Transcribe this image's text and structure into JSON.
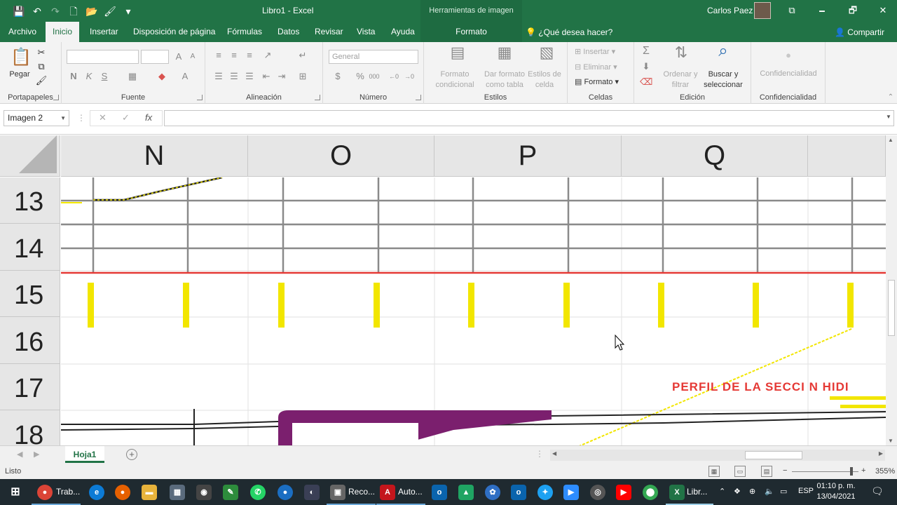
{
  "window": {
    "title": "Libro1  -  Excel",
    "context_tab_group": "Herramientas de imagen",
    "user": "Carlos Paez",
    "minimize": "🗕",
    "restore": "🗗",
    "close": "✕",
    "ribbon_display": "⧉"
  },
  "qat": {
    "save": "💾",
    "undo": "↶",
    "redo": "↷",
    "new": "🗋",
    "open": "📂",
    "brush": "🖌",
    "more": "▾"
  },
  "tabs": [
    "Archivo",
    "Inicio",
    "Insertar",
    "Disposición de página",
    "Fórmulas",
    "Datos",
    "Revisar",
    "Vista",
    "Ayuda",
    "Formato"
  ],
  "active_tab": "Inicio",
  "help_text": "¿Qué desea hacer?",
  "share_label": "Compartir",
  "ribbon": {
    "clipboard": {
      "label": "Portapapeles",
      "paste": "Pegar"
    },
    "font": {
      "label": "Fuente",
      "bold": "N",
      "italic": "K",
      "underline": "S"
    },
    "alignment": {
      "label": "Alineación"
    },
    "number": {
      "label": "Número",
      "format_value": "General",
      "currency": "$",
      "percent": "%",
      "thousands": "000"
    },
    "styles": {
      "label": "Estilos",
      "conditional": [
        "Formato",
        "condicional"
      ],
      "table": [
        "Dar formato",
        "como tabla"
      ],
      "cell_styles": [
        "Estilos de",
        "celda"
      ]
    },
    "cells": {
      "label": "Celdas",
      "insert": "Insertar",
      "delete": "Eliminar",
      "format": "Formato"
    },
    "editing": {
      "label": "Edición",
      "sort": [
        "Ordenar y",
        "filtrar"
      ],
      "find": [
        "Buscar y",
        "seleccionar"
      ]
    },
    "sensitivity": {
      "label": "Confidencialidad",
      "button": "Confidencialidad"
    }
  },
  "formula_bar": {
    "name_box": "Imagen 2",
    "cancel": "✕",
    "enter": "✓",
    "fx": "fx",
    "value": ""
  },
  "columns": [
    "N",
    "O",
    "P",
    "Q"
  ],
  "rows": [
    "13",
    "14",
    "15",
    "16",
    "17",
    "18"
  ],
  "drawing": {
    "profile_title": "PERFIL DE LA SECCI N HIDI"
  },
  "sheet": {
    "tab": "Hoja1",
    "add": "+"
  },
  "status": {
    "ready": "Listo",
    "zoom": "355%",
    "zoom_minus": "−",
    "zoom_plus": "+"
  },
  "taskbar": {
    "items": [
      "Trab...",
      "Reco...",
      "Auto...",
      "Libr..."
    ],
    "lang": "ESP",
    "time": "01:10 p. m.",
    "date": "13/04/2021"
  }
}
